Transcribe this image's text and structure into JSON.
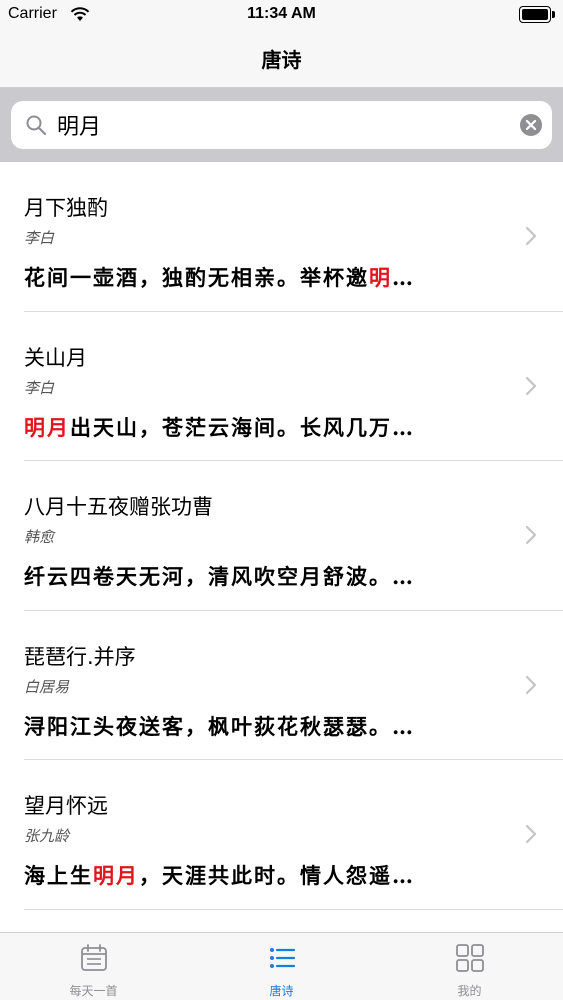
{
  "status_bar": {
    "carrier": "Carrier",
    "time": "11:34 AM"
  },
  "nav": {
    "title": "唐诗"
  },
  "search": {
    "value": "明月",
    "icon": "search-icon",
    "clear_icon": "clear-icon"
  },
  "colors": {
    "highlight": "#e0161d",
    "tab_active": "#1a7ce8",
    "tab_inactive": "#8e8e93",
    "search_band": "#c9c9ce"
  },
  "poems": [
    {
      "title": "月下独酌",
      "author": "李白",
      "excerpt": [
        {
          "t": "花间一壶酒，独酌无相亲。举杯邀",
          "h": false
        },
        {
          "t": "明",
          "h": true
        },
        {
          "t": "…",
          "h": false
        }
      ]
    },
    {
      "title": "关山月",
      "author": "李白",
      "excerpt": [
        {
          "t": "明月",
          "h": true
        },
        {
          "t": "出天山，苍茫云海间。长风几万…",
          "h": false
        }
      ]
    },
    {
      "title": "八月十五夜赠张功曹",
      "author": "韩愈",
      "excerpt": [
        {
          "t": "纤云四卷天无河，清风吹空月舒波。…",
          "h": false
        }
      ]
    },
    {
      "title": "琵琶行.并序",
      "author": "白居易",
      "excerpt": [
        {
          "t": "浔阳江头夜送客，枫叶荻花秋瑟瑟。…",
          "h": false
        }
      ]
    },
    {
      "title": "望月怀远",
      "author": "张九龄",
      "excerpt": [
        {
          "t": "海上生",
          "h": false
        },
        {
          "t": "明月",
          "h": true
        },
        {
          "t": "，天涯共此时。情人怨遥…",
          "h": false
        }
      ]
    }
  ],
  "tabs": [
    {
      "label": "每天一首",
      "icon": "calendar-icon",
      "active": false
    },
    {
      "label": "唐诗",
      "icon": "list-icon",
      "active": true
    },
    {
      "label": "我的",
      "icon": "grid-icon",
      "active": false
    }
  ]
}
